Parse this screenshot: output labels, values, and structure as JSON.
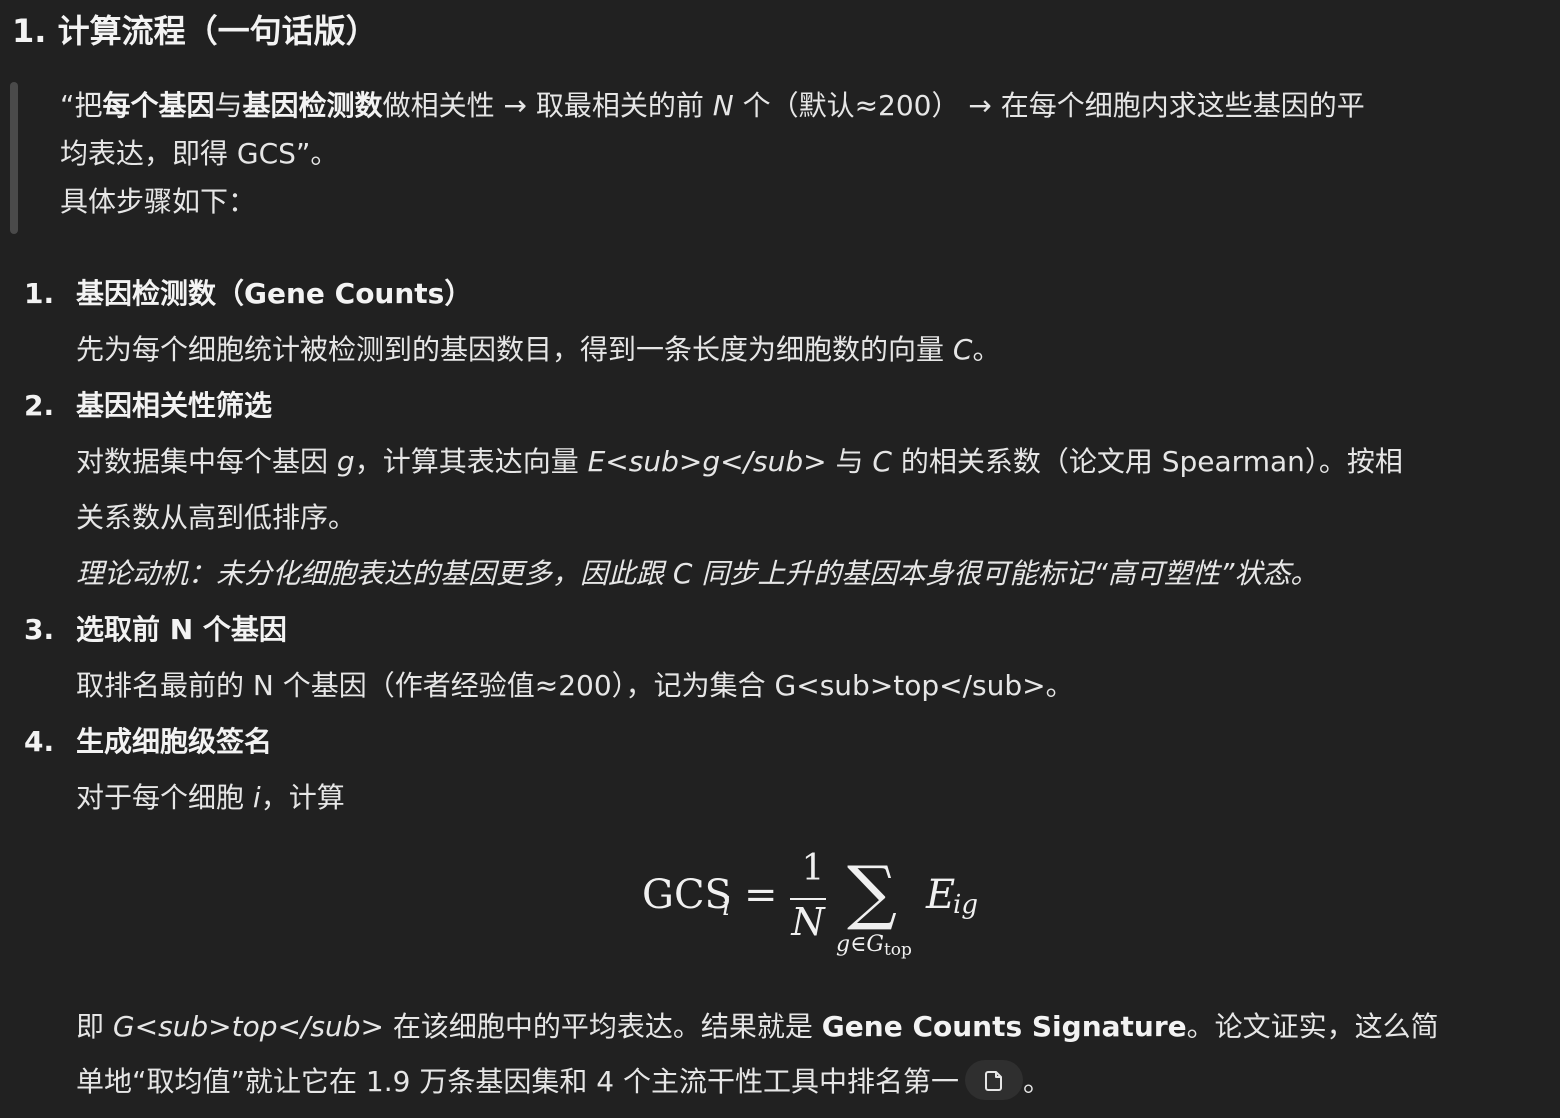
{
  "heading": "1. 计算流程（一句话版）",
  "quote": {
    "line1_a": "“把",
    "line1_b": "每个基因",
    "line1_c": "与",
    "line1_d": "基因检测数",
    "line1_e": "做相关性 → 取最相关的前 ",
    "line1_f": "N",
    "line1_g": " 个（默认≈200） → 在每个细胞内求这些基因的平",
    "line2": "均表达，即得 GCS”。",
    "line3": "具体步骤如下："
  },
  "steps": [
    {
      "num": "1.",
      "title": "基因检测数（Gene Counts）",
      "body1_a": "先为每个细胞统计被检测到的基因数目，得到一条长度为细胞数的向量 ",
      "body1_b": "C",
      "body1_c": "。"
    },
    {
      "num": "2.",
      "title": "基因相关性筛选",
      "body1_a": "对数据集中每个基因 ",
      "body1_b": "g",
      "body1_c": "，计算其表达向量 ",
      "body1_d": "E<sub>g</sub>",
      "body1_e": " 与 ",
      "body1_f": "C",
      "body1_g": " 的相关系数（论文用 Spearman）。按相",
      "body2": "关系数从高到低排序。",
      "body3": "理论动机：未分化细胞表达的基因更多，因此跟 C 同步上升的基因本身很可能标记“高可塑性”状态。"
    },
    {
      "num": "3.",
      "title": "选取前 N 个基因",
      "body1": "取排名最前的 N 个基因（作者经验值≈200），记为集合 G<sub>top</sub>。"
    },
    {
      "num": "4.",
      "title": "生成细胞级签名",
      "body1_a": "对于每个细胞 ",
      "body1_b": "i",
      "body1_c": "，计算"
    }
  ],
  "formula": {
    "lhs": "GCS",
    "lhs_sub": "i",
    "eq": "=",
    "num": "1",
    "den": "N",
    "sum": "∑",
    "sum_sub_a": "g∈G",
    "sum_sub_b": "top",
    "term": "E",
    "term_sub": "ig"
  },
  "closing": {
    "l1_a": "即 ",
    "l1_b": "G<sub>top</sub>",
    "l1_c": " 在该细胞中的平均表达。结果就是 ",
    "l1_d": "Gene Counts Signature",
    "l1_e": "。论文证实，这么简",
    "l2_a": "单地“取均值”就让它在 1.9 万条基因集和 4 个主流干性工具中排名第一",
    "l2_b": "。"
  },
  "icons": {
    "copy": "copy-icon"
  }
}
